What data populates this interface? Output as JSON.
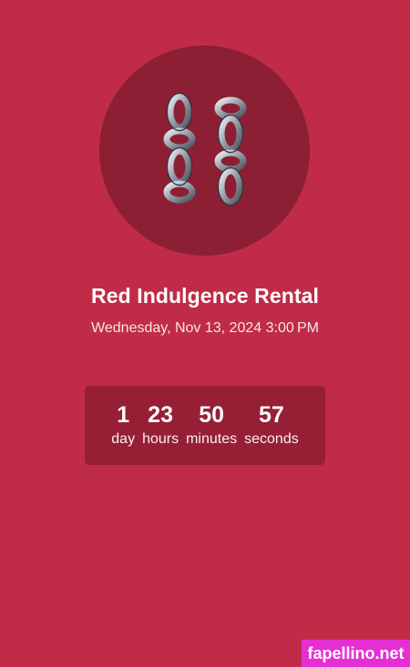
{
  "event": {
    "icon": "chains-icon",
    "title": "Red Indulgence Rental",
    "datetime": "Wednesday, Nov 13, 2024 3:00 PM"
  },
  "countdown": {
    "days": {
      "value": "1",
      "label": "day"
    },
    "hours": {
      "value": "23",
      "label": "hours"
    },
    "minutes": {
      "value": "50",
      "label": "minutes"
    },
    "seconds": {
      "value": "57",
      "label": "seconds"
    }
  },
  "watermark": {
    "text": "fapellino.net"
  },
  "colors": {
    "background": "#c02c48",
    "circle": "#8c1f33",
    "countdown_box": "#961f36",
    "watermark_bg": "#e62fd3"
  }
}
